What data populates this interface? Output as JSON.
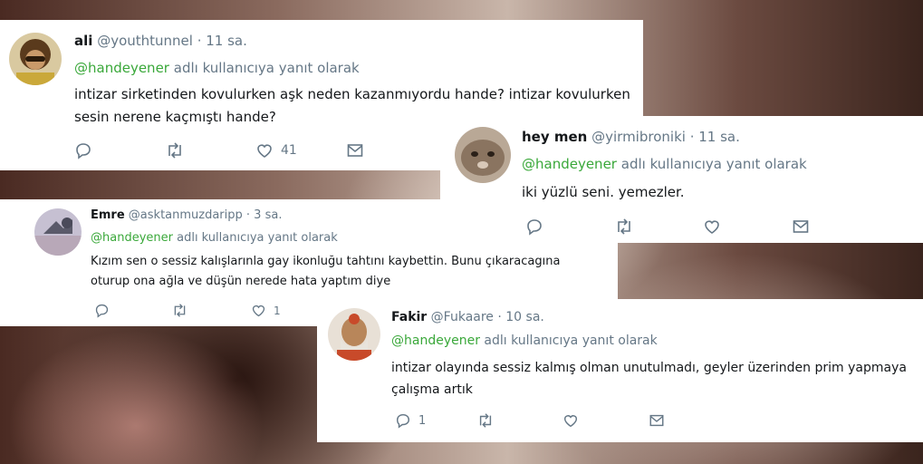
{
  "tweets": [
    {
      "name": "ali",
      "handle": "@youthtunnel",
      "time": "· 11 sa.",
      "mention": "@handeyener",
      "reply_suffix": "adlı kullanıcıya yanıt olarak",
      "text": "intizar sirketinden kovulurken aşk neden kazanmıyordu hande? intizar kovulurken sesin nerene kaçmıştı hande?",
      "like_count": "41",
      "reply_count": ""
    },
    {
      "name": "hey men",
      "handle": "@yirmibroniki",
      "time": "· 11 sa.",
      "mention": "@handeyener",
      "reply_suffix": "adlı kullanıcıya yanıt olarak",
      "text": "iki yüzlü seni. yemezler.",
      "like_count": "",
      "reply_count": ""
    },
    {
      "name": "Emre",
      "handle": "@asktanmuzdaripp",
      "time": "· 3 sa.",
      "mention": "@handeyener",
      "reply_suffix": "adlı kullanıcıya yanıt olarak",
      "text": "Kızım sen o sessiz kalışlarınla gay ikonluğu tahtını kaybettin. Bunu çıkaracagına oturup ona ağla ve düşün nerede hata yaptım diye",
      "like_count": "1",
      "reply_count": ""
    },
    {
      "name": "Fakir",
      "handle": "@Fukaare",
      "time": "· 10 sa.",
      "mention": "@handeyener",
      "reply_suffix": "adlı kullanıcıya yanıt olarak",
      "text": "intizar olayında sessiz kalmış olman unutulmadı, geyler üzerinden prim yapmaya çalışma artık",
      "like_count": "",
      "reply_count": "1"
    }
  ],
  "icons": [
    "reply-icon",
    "retweet-icon",
    "like-icon",
    "message-icon"
  ],
  "colors": {
    "mention": "#3aa83a",
    "meta": "#657786",
    "text": "#14171a"
  }
}
